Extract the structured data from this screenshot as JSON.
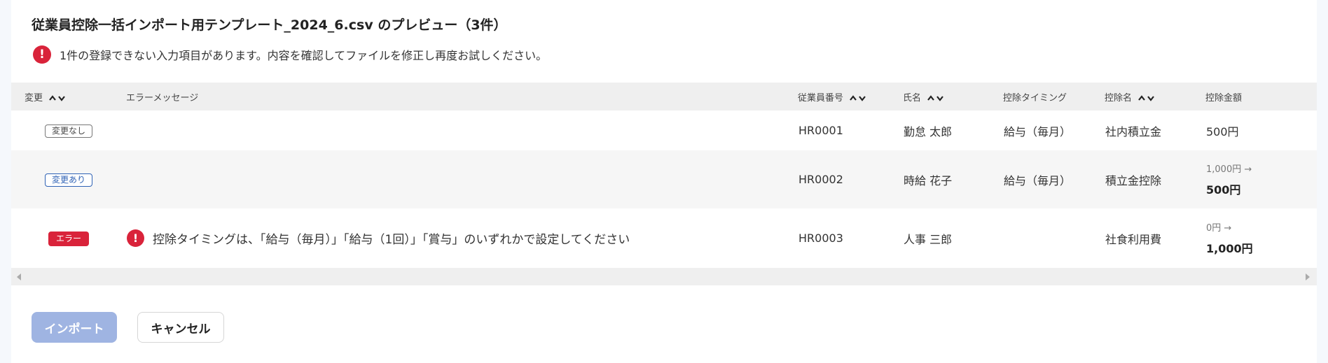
{
  "preview": {
    "title": "従業員控除一括インポート用テンプレート_2024_6.csv のプレビュー（3件）",
    "alert": {
      "icon": "error-icon",
      "text": "1件の登録できない入力項目があります。内容を確認してファイルを修正し再度お試しください。"
    }
  },
  "table": {
    "columns": {
      "change": "変更",
      "error_message": "エラーメッセージ",
      "employee_number": "従業員番号",
      "name": "氏名",
      "deduction_timing": "控除タイミング",
      "deduction_name": "控除名",
      "deduction_amount": "控除金額"
    },
    "rows": [
      {
        "status": "変更なし",
        "error_message": "",
        "employee_number": "HR0001",
        "name": "勤怠 太郎",
        "deduction_timing": "給与（毎月）",
        "deduction_name": "社内積立金",
        "amount": "500円"
      },
      {
        "status": "変更あり",
        "error_message": "",
        "employee_number": "HR0002",
        "name": "時給 花子",
        "deduction_timing": "給与（毎月）",
        "deduction_name": "積立金控除",
        "amount_old": "1,000円 →",
        "amount_new": "500円"
      },
      {
        "status": "エラー",
        "error_message": "控除タイミングは、「給与（毎月）」「給与（1回）」「賞与」のいずれかで設定してください",
        "employee_number": "HR0003",
        "name": "人事 三郎",
        "deduction_timing": "",
        "deduction_name": "社食利用費",
        "amount_old": "0円 →",
        "amount_new": "1,000円"
      }
    ]
  },
  "buttons": {
    "import": "インポート",
    "cancel": "キャンセル"
  },
  "colors": {
    "error": "#d9233a",
    "changed_badge": "#2f62b5",
    "import_button_disabled": "#9fb4e2",
    "header_bg": "#efefef"
  }
}
